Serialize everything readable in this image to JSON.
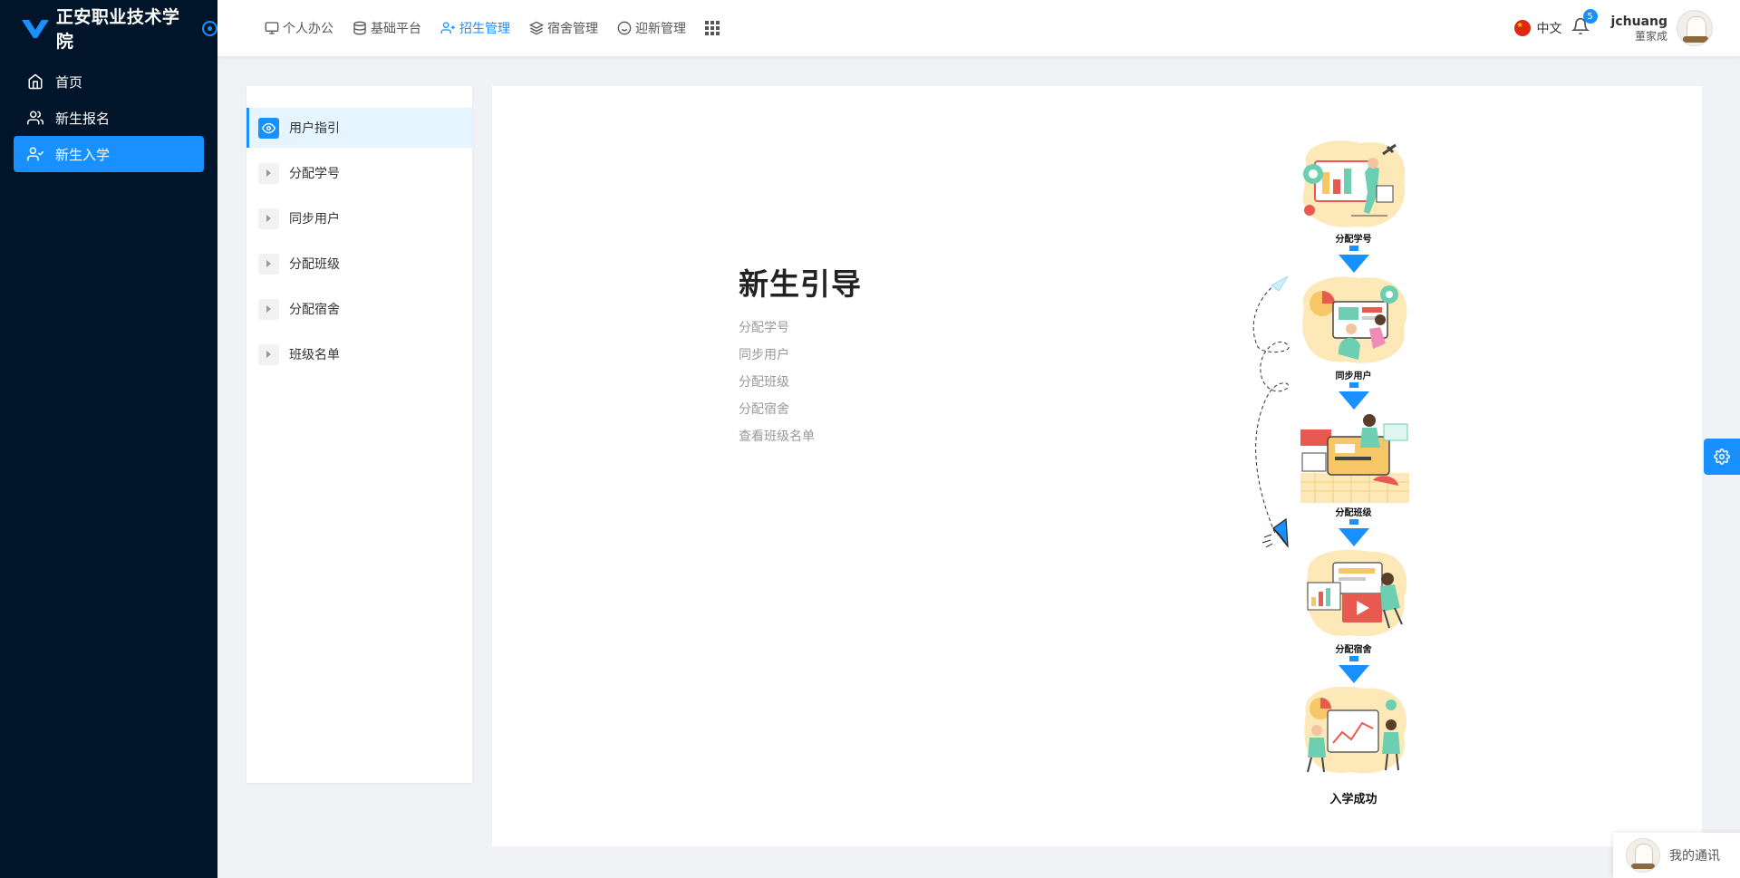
{
  "app": {
    "title": "正安职业技术学院"
  },
  "sidebar": {
    "items": [
      {
        "label": "首页",
        "icon": "home-icon"
      },
      {
        "label": "新生报名",
        "icon": "users-icon"
      },
      {
        "label": "新生入学",
        "icon": "user-check-icon",
        "active": true
      }
    ]
  },
  "topnav": {
    "items": [
      {
        "label": "个人办公",
        "icon": "monitor-icon"
      },
      {
        "label": "基础平台",
        "icon": "database-icon"
      },
      {
        "label": "招生管理",
        "icon": "user-plus-icon",
        "active": true
      },
      {
        "label": "宿舍管理",
        "icon": "layers-icon"
      },
      {
        "label": "迎新管理",
        "icon": "smile-icon"
      }
    ]
  },
  "header": {
    "language": "中文",
    "notification_count": "5",
    "username": "jchuang",
    "user_fullname": "董家成"
  },
  "steps": {
    "items": [
      {
        "label": "用户指引",
        "active": true
      },
      {
        "label": "分配学号"
      },
      {
        "label": "同步用户"
      },
      {
        "label": "分配班级"
      },
      {
        "label": "分配宿舍"
      },
      {
        "label": "班级名单"
      }
    ]
  },
  "guide": {
    "title": "新生引导",
    "items": [
      "分配学号",
      "同步用户",
      "分配班级",
      "分配宿舍",
      "查看班级名单"
    ]
  },
  "flow": {
    "steps": [
      "分配学号",
      "同步用户",
      "分配班级",
      "分配宿舍"
    ],
    "final": "入学成功"
  },
  "chat": {
    "label": "我的通讯"
  },
  "colors": {
    "primary": "#1890ff",
    "sidebar_bg": "#001529"
  }
}
